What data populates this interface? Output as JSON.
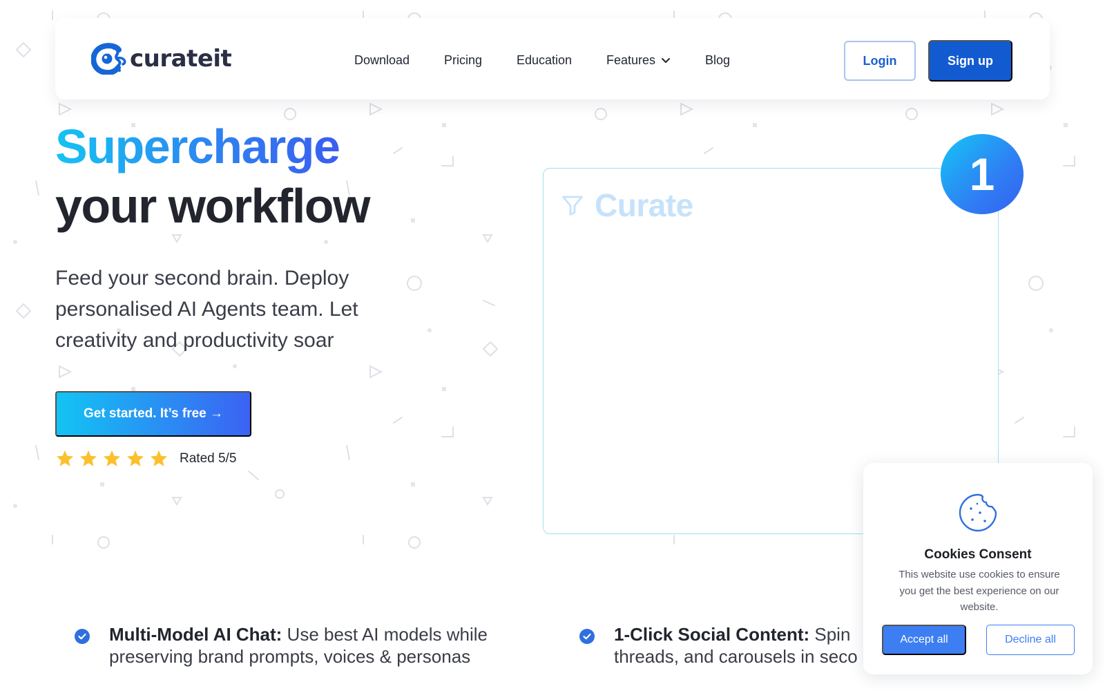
{
  "nav": {
    "brand": "curateit",
    "links": [
      {
        "label": "Download"
      },
      {
        "label": "Pricing"
      },
      {
        "label": "Education"
      },
      {
        "label": "Features"
      },
      {
        "label": "Blog"
      }
    ],
    "login_label": "Login",
    "signup_label": "Sign up"
  },
  "hero": {
    "title_line1": "Supercharge",
    "title_line2": "your workflow",
    "subtitle": "Feed your second brain. Deploy personalised AI Agents team. Let creativity and productivity soar",
    "cta_label": "Get started. It’s free →",
    "rating_text": "Rated 5/5",
    "rating_value": 5,
    "rating_max": 5
  },
  "demo": {
    "title": "Curate",
    "step_number": "1"
  },
  "features": [
    {
      "title": "Multi-Model AI Chat:",
      "line1": " Use best AI models while",
      "line2": "preserving brand prompts, voices & personas"
    },
    {
      "title": "1-Click Social Content:",
      "line1": " Spin",
      "line2": "threads, and carousels in seco"
    }
  ],
  "cookie": {
    "title": "Cookies Consent",
    "description": "This website use cookies to ensure you get the best experience on our website.",
    "accept_label": "Accept all",
    "decline_label": "Decline all"
  },
  "colors": {
    "primary": "#125ad0",
    "accent_cyan": "#15c3f2",
    "accent_blue": "#3a5df0",
    "text_dark": "#22252e",
    "star": "#fbc02d",
    "cookie_button": "#3d7ef2"
  },
  "icons": {
    "logo": "octopus-c-logo",
    "features_caret": "chevron-down-icon",
    "demo": "filter-icon",
    "check": "check-circle-icon",
    "cookie": "cookie-icon",
    "star": "star-icon"
  }
}
